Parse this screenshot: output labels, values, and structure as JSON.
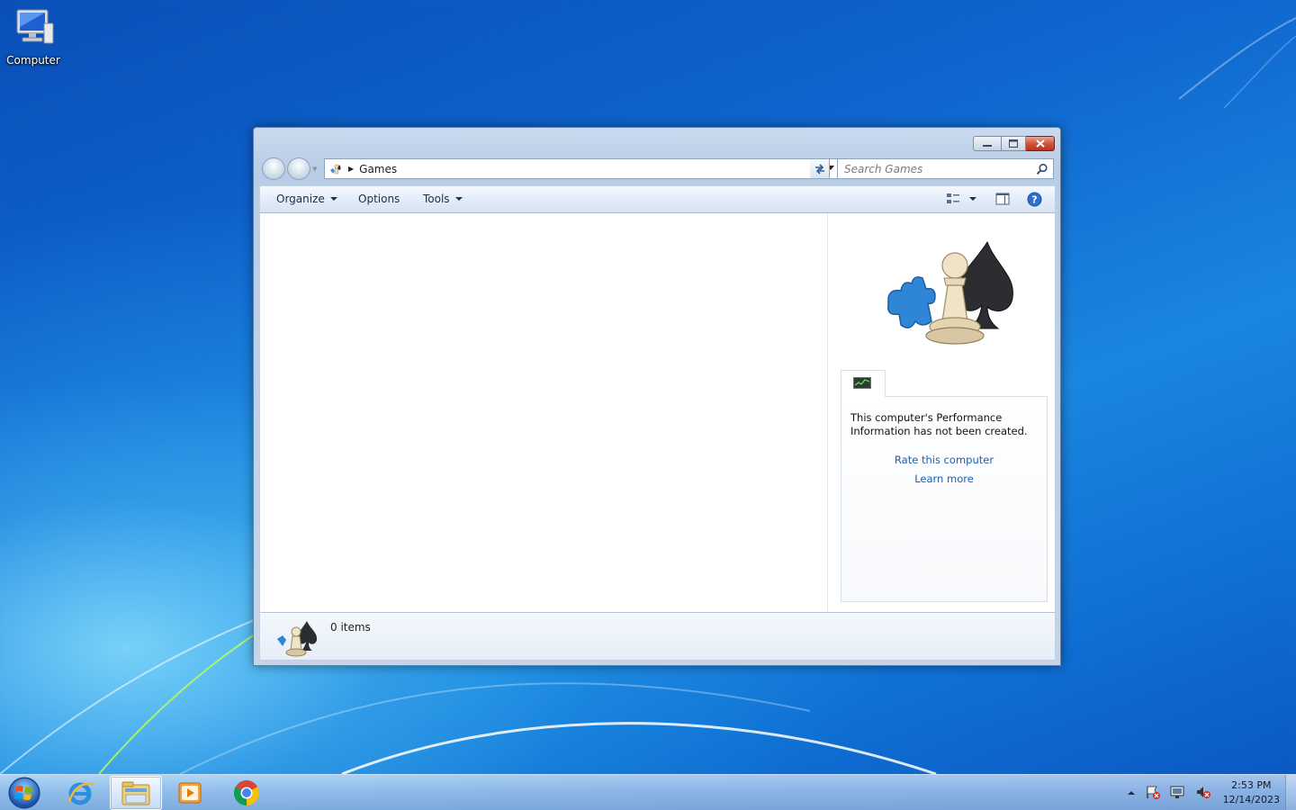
{
  "desktop": {
    "icons": [
      {
        "label": "Computer",
        "icon": "computer-icon"
      }
    ]
  },
  "window": {
    "address": {
      "path": "Games",
      "icon": "games-icon"
    },
    "search": {
      "placeholder": "Search Games"
    },
    "commandbar": {
      "organize_label": "Organize",
      "options_label": "Options",
      "tools_label": "Tools"
    },
    "performance": {
      "message": "This computer's Performance Information has not been created.",
      "rate_link": "Rate this computer",
      "learn_link": "Learn more"
    },
    "details": {
      "count": "0 items"
    },
    "colors": {
      "link": "#1b5fae",
      "close_button": "#c8432c"
    }
  },
  "taskbar": {
    "pinned": [
      "internet-explorer-icon",
      "windows-explorer-icon",
      "windows-media-player-icon",
      "chrome-icon"
    ],
    "active": "windows-explorer-icon",
    "clock": {
      "time": "2:53 PM",
      "date": "12/14/2023"
    }
  }
}
